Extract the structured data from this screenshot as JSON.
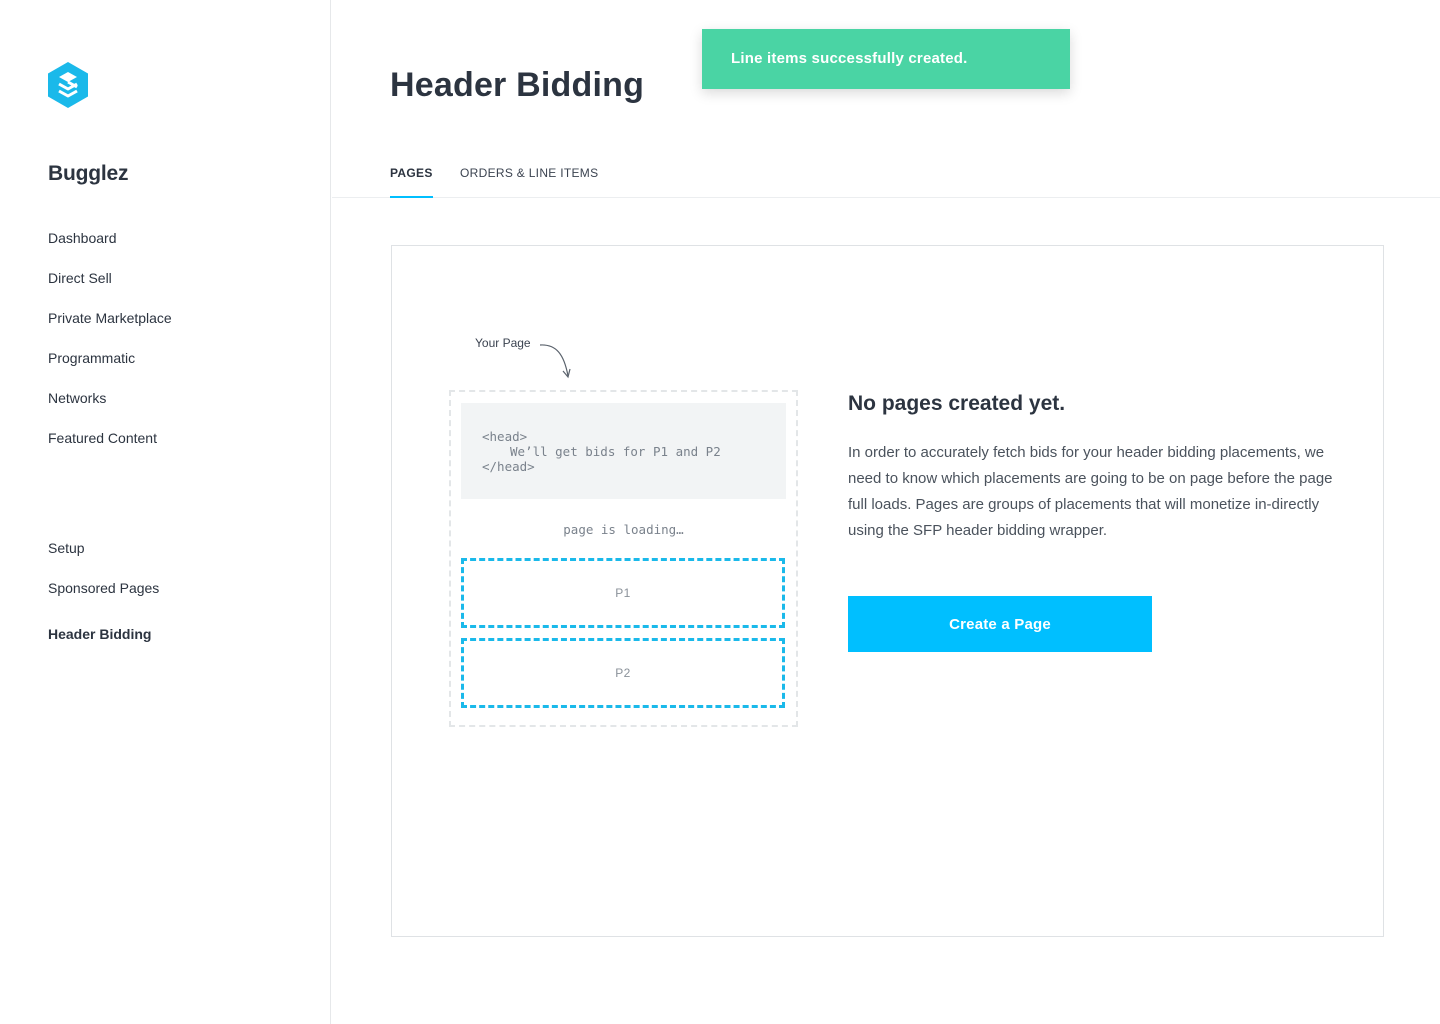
{
  "app": {
    "brand_name": "Bugglez",
    "logo_icon": "stacked-layers-hexagon-icon",
    "accent_color": "#00bfff",
    "success_color": "#4ad4a4"
  },
  "sidebar": {
    "main_items": [
      {
        "label": "Dashboard"
      },
      {
        "label": "Direct Sell"
      },
      {
        "label": "Private Marketplace"
      },
      {
        "label": "Programmatic"
      },
      {
        "label": "Networks"
      },
      {
        "label": "Featured Content"
      }
    ],
    "secondary_items": [
      {
        "label": "Setup"
      },
      {
        "label": "Sponsored Pages"
      },
      {
        "label": "Header Bidding",
        "active": true
      }
    ]
  },
  "header": {
    "title": "Header Bidding"
  },
  "toast": {
    "message": "Line items successfully created."
  },
  "tabs": [
    {
      "label": "PAGES",
      "active": true
    },
    {
      "label": "ORDERS & LINE ITEMS",
      "active": false
    }
  ],
  "illustration": {
    "caption": "Your Page",
    "code_line1": "<head>",
    "code_line2": "We’ll get bids for P1 and P2",
    "code_line3": "</head>",
    "loading_text": "page is loading…",
    "slot1": "P1",
    "slot2": "P2"
  },
  "empty_state": {
    "title": "No pages created yet.",
    "description": "In order to accurately fetch bids for your header bidding placements, we need to know which placements are going to be on page before the page full loads. Pages are groups of placements that will monetize in-directly using the SFP header bidding wrapper.",
    "button_label": "Create a Page"
  }
}
